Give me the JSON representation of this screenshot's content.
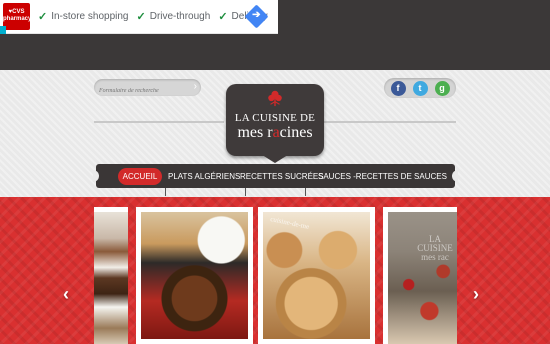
{
  "ad": {
    "logo_line1": "♥CVS",
    "logo_line2": "pharmacy",
    "items": [
      "In-store shopping",
      "Drive-through",
      "Delivery"
    ]
  },
  "search": {
    "placeholder": "Formulaire de recherche"
  },
  "social": {
    "facebook": "f",
    "twitter": "t",
    "google": "g"
  },
  "logo": {
    "line1": "LA CUISINE DE",
    "line2_a": "mes r",
    "line2_b": "a",
    "line2_c": "cines"
  },
  "nav": {
    "items": [
      "ACCUEIL",
      "PLATS ALGÉRIENS",
      "RECETTES SUCRÉES",
      "SAUCES -RECETTES DE SAUCES"
    ],
    "active_index": 0
  },
  "slider": {
    "watermark": "cuisine-de-me",
    "watermark4_l1": "LA CUISINE",
    "watermark4_l2": "mes rac",
    "prev": "‹",
    "next": "›"
  },
  "colors": {
    "accent": "#d22a2a",
    "dark": "#3a3636",
    "header_bg": "#e9e9e9",
    "slider_bg": "#d93030"
  }
}
